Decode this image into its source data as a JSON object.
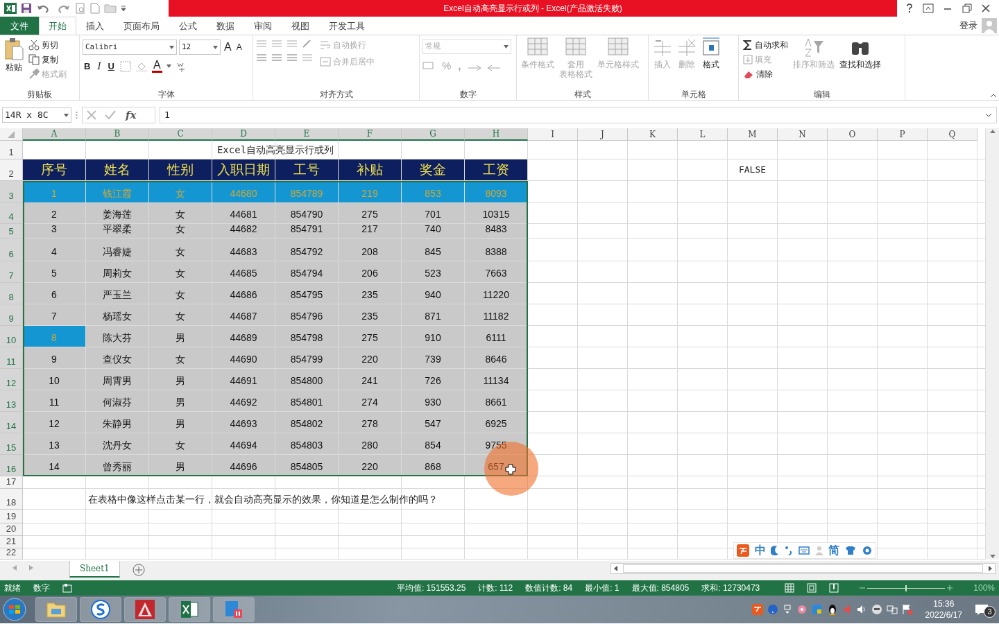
{
  "window": {
    "title": "Excel自动高亮显示行或列 - Excel(产品激活失败)"
  },
  "ribbon": {
    "tabs": [
      {
        "label": "文件",
        "kind": "file",
        "selected": false
      },
      {
        "label": "开始",
        "kind": "tab",
        "selected": true
      },
      {
        "label": "插入",
        "kind": "tab",
        "selected": false
      },
      {
        "label": "页面布局",
        "kind": "tab",
        "selected": false
      },
      {
        "label": "公式",
        "kind": "tab",
        "selected": false
      },
      {
        "label": "数据",
        "kind": "tab",
        "selected": false
      },
      {
        "label": "审阅",
        "kind": "tab",
        "selected": false
      },
      {
        "label": "视图",
        "kind": "tab",
        "selected": false
      },
      {
        "label": "开发工具",
        "kind": "tab",
        "selected": false
      }
    ],
    "login": "登录",
    "groups": [
      {
        "label": "剪贴板",
        "items": [
          {
            "label": "粘贴",
            "disabled": false
          },
          {
            "label": "剪切",
            "disabled": false
          },
          {
            "label": "复制",
            "disabled": false
          },
          {
            "label": "格式刷",
            "disabled": true
          }
        ]
      },
      {
        "label": "字体",
        "font": "Calibri",
        "size": "12",
        "items": [
          {
            "label": "A",
            "disabled": false
          },
          {
            "label": "A",
            "disabled": false
          },
          {
            "label": "B",
            "disabled": false
          },
          {
            "label": "I",
            "disabled": false
          },
          {
            "label": "U",
            "disabled": false
          },
          {
            "label": "A",
            "disabled": false
          }
        ]
      },
      {
        "label": "对齐方式",
        "items": [
          {
            "label": "自动换行",
            "disabled": true
          },
          {
            "label": "合并后居中",
            "disabled": true
          }
        ]
      },
      {
        "label": "数字",
        "format": "常规",
        "items": [
          {
            "label": "%",
            "disabled": true
          },
          {
            "label": ",",
            "disabled": true
          }
        ]
      },
      {
        "label": "样式",
        "items": [
          {
            "label": "条件格式",
            "disabled": true
          },
          {
            "label": "套用",
            "sublabel": "表格格式",
            "disabled": true
          },
          {
            "label": "单元格样式",
            "disabled": true
          }
        ]
      },
      {
        "label": "单元格",
        "items": [
          {
            "label": "插入",
            "disabled": true
          },
          {
            "label": "删除",
            "disabled": true
          },
          {
            "label": "格式",
            "disabled": false
          }
        ]
      },
      {
        "label": "编辑",
        "items": [
          {
            "label": "自动求和",
            "disabled": false
          },
          {
            "label": "填充",
            "disabled": true
          },
          {
            "label": "清除",
            "disabled": false
          },
          {
            "label": "排序和筛选",
            "disabled": true
          },
          {
            "label": "查找和选择",
            "disabled": false
          }
        ]
      }
    ]
  },
  "formula_bar": {
    "name_box": "14R x 8C",
    "fx": "fx",
    "value": "1"
  },
  "sheet": {
    "columns": [
      {
        "label": "A",
        "selected": true
      },
      {
        "label": "B",
        "selected": true
      },
      {
        "label": "C",
        "selected": true
      },
      {
        "label": "D",
        "selected": true
      },
      {
        "label": "E",
        "selected": true
      },
      {
        "label": "F",
        "selected": true
      },
      {
        "label": "G",
        "selected": true
      },
      {
        "label": "H",
        "selected": true
      },
      {
        "label": "I",
        "selected": false
      },
      {
        "label": "J",
        "selected": false
      },
      {
        "label": "K",
        "selected": false
      },
      {
        "label": "L",
        "selected": false
      },
      {
        "label": "M",
        "selected": false
      },
      {
        "label": "N",
        "selected": false
      },
      {
        "label": "O",
        "selected": false
      },
      {
        "label": "P",
        "selected": false
      },
      {
        "label": "Q",
        "selected": false
      }
    ],
    "rows": [
      {
        "number": "1",
        "selected": false,
        "kind": "title",
        "text": "Excel自动高亮显示行或列"
      },
      {
        "number": "2",
        "selected": false,
        "kind": "header",
        "cells": [
          "序号",
          "姓名",
          "性别",
          "入职日期",
          "工号",
          "补贴",
          "奖金",
          "工资"
        ],
        "side_value": "FALSE"
      },
      {
        "number": "3",
        "selected": true,
        "kind": "data",
        "highlighted": true,
        "index_highlighted": true,
        "cells": [
          "1",
          "钱江霞",
          "女",
          "44680",
          "854789",
          "219",
          "853",
          "8093"
        ]
      },
      {
        "number": "4",
        "selected": true,
        "kind": "data",
        "highlighted": false,
        "index_highlighted": false,
        "cells": [
          "2",
          "姜海莲",
          "女",
          "44681",
          "854790",
          "275",
          "701",
          "10315"
        ]
      },
      {
        "number": "5",
        "selected": true,
        "kind": "data",
        "highlighted": false,
        "index_highlighted": false,
        "cells": [
          "3",
          "平翠柔",
          "女",
          "44682",
          "854791",
          "217",
          "740",
          "8483"
        ]
      },
      {
        "number": "6",
        "selected": true,
        "kind": "data",
        "highlighted": false,
        "index_highlighted": false,
        "cells": [
          "4",
          "冯睿婕",
          "女",
          "44683",
          "854792",
          "208",
          "845",
          "8388"
        ]
      },
      {
        "number": "7",
        "selected": true,
        "kind": "data",
        "highlighted": false,
        "index_highlighted": false,
        "cells": [
          "5",
          "周莉女",
          "女",
          "44685",
          "854794",
          "206",
          "523",
          "7663"
        ]
      },
      {
        "number": "8",
        "selected": true,
        "kind": "data",
        "highlighted": false,
        "index_highlighted": false,
        "cells": [
          "6",
          "严玉兰",
          "女",
          "44686",
          "854795",
          "235",
          "940",
          "11220"
        ]
      },
      {
        "number": "9",
        "selected": true,
        "kind": "data",
        "highlighted": false,
        "index_highlighted": false,
        "cells": [
          "7",
          "杨瑶女",
          "女",
          "44687",
          "854796",
          "235",
          "871",
          "11182"
        ]
      },
      {
        "number": "10",
        "selected": true,
        "kind": "data",
        "highlighted": false,
        "index_highlighted": true,
        "cells": [
          "8",
          "陈大芬",
          "男",
          "44689",
          "854798",
          "275",
          "910",
          "6111"
        ]
      },
      {
        "number": "11",
        "selected": true,
        "kind": "data",
        "highlighted": false,
        "index_highlighted": false,
        "cells": [
          "9",
          "查仪女",
          "女",
          "44690",
          "854799",
          "220",
          "739",
          "8646"
        ]
      },
      {
        "number": "12",
        "selected": true,
        "kind": "data",
        "highlighted": false,
        "index_highlighted": false,
        "cells": [
          "10",
          "周霄男",
          "男",
          "44691",
          "854800",
          "241",
          "726",
          "11134"
        ]
      },
      {
        "number": "13",
        "selected": true,
        "kind": "data",
        "highlighted": false,
        "index_highlighted": false,
        "cells": [
          "11",
          "何淑芬",
          "男",
          "44692",
          "854801",
          "274",
          "930",
          "8661"
        ]
      },
      {
        "number": "14",
        "selected": true,
        "kind": "data",
        "highlighted": false,
        "index_highlighted": false,
        "cells": [
          "12",
          "朱静男",
          "男",
          "44693",
          "854802",
          "278",
          "547",
          "6925"
        ]
      },
      {
        "number": "15",
        "selected": true,
        "kind": "data",
        "highlighted": false,
        "index_highlighted": false,
        "cells": [
          "13",
          "沈丹女",
          "女",
          "44694",
          "854803",
          "280",
          "854",
          "9755"
        ]
      },
      {
        "number": "16",
        "selected": true,
        "kind": "data",
        "highlighted": false,
        "index_highlighted": false,
        "cells": [
          "14",
          "曾秀丽",
          "男",
          "44696",
          "854805",
          "220",
          "868",
          "657"
        ]
      },
      {
        "number": "17",
        "selected": false,
        "kind": "blank"
      },
      {
        "number": "18",
        "selected": false,
        "kind": "note",
        "text": "在表格中像这样点击某一行，就会自动高亮显示的效果，你知道是怎么制作的吗？"
      },
      {
        "number": "19",
        "selected": false,
        "kind": "blank"
      },
      {
        "number": "20",
        "selected": false,
        "kind": "blank"
      },
      {
        "number": "21",
        "selected": false,
        "kind": "blank"
      },
      {
        "number": "22",
        "selected": false,
        "kind": "blank"
      }
    ]
  },
  "ime": {
    "mode": "中",
    "script": "简"
  },
  "sheet_tabs": [
    {
      "label": "Sheet1",
      "selected": true
    }
  ],
  "status_bar": {
    "left": [
      "就绪",
      "数字"
    ],
    "stats": [
      "平均值: 151553.25",
      "计数: 112",
      "数值计数: 84",
      "最小值: 1",
      "最大值: 854805",
      "求和: 12730473"
    ],
    "zoom_slider": {
      "level": 0.5
    },
    "zoom": "100%"
  },
  "taskbar": {
    "time": "15:36",
    "date": "2022/6/17",
    "notifications": "3"
  }
}
